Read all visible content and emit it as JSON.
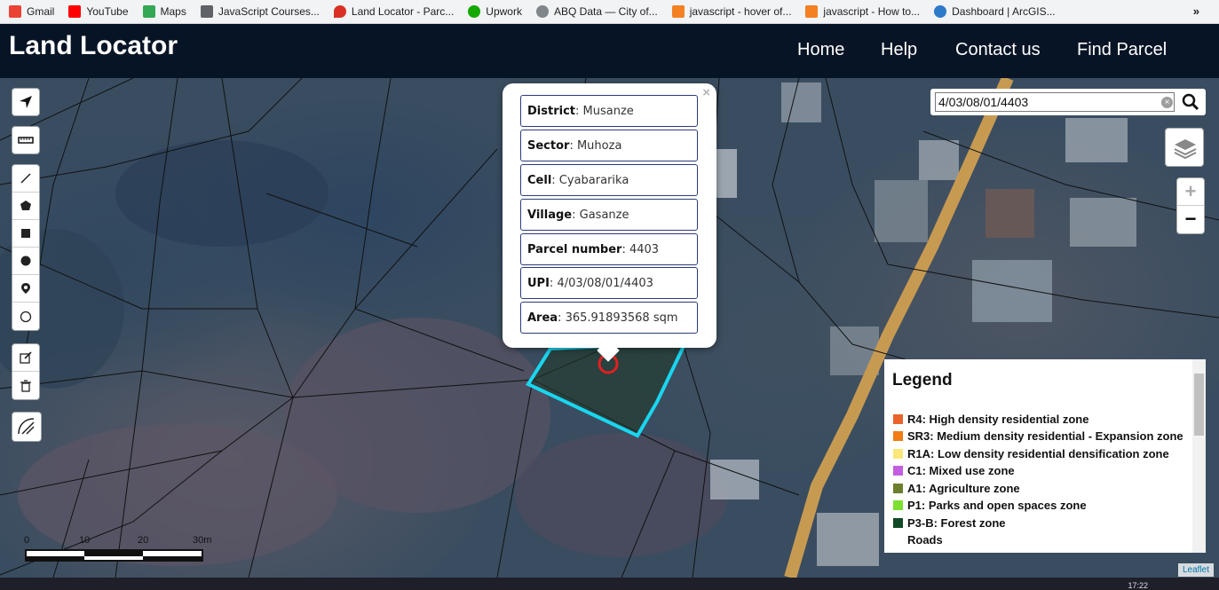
{
  "bookmarks": [
    {
      "label": "Gmail",
      "icon": "gmail-icon",
      "color": "#ea4335"
    },
    {
      "label": "YouTube",
      "icon": "youtube-icon",
      "color": "#ff0000"
    },
    {
      "label": "Maps",
      "icon": "maps-icon",
      "color": "#34a853"
    },
    {
      "label": "JavaScript Courses...",
      "icon": "page-icon",
      "color": "#5f6368"
    },
    {
      "label": "Land Locator - Parc...",
      "icon": "pin-icon",
      "color": "#d93025"
    },
    {
      "label": "Upwork",
      "icon": "upwork-icon",
      "color": "#14a800"
    },
    {
      "label": "ABQ Data — City of...",
      "icon": "globe-icon",
      "color": "#80868b"
    },
    {
      "label": "javascript - hover of...",
      "icon": "stackoverflow-icon",
      "color": "#f48024"
    },
    {
      "label": "javascript - How to...",
      "icon": "stackoverflow-icon",
      "color": "#f48024"
    },
    {
      "label": "Dashboard | ArcGIS...",
      "icon": "arcgis-icon",
      "color": "#2c7ac9"
    }
  ],
  "bookmarks_more": "»",
  "header": {
    "brand": "Land Locator",
    "nav": [
      "Home",
      "Help",
      "Contact us",
      "Find Parcel"
    ]
  },
  "search": {
    "value": "4/03/08/01/4403",
    "clear": "×"
  },
  "zoom": {
    "in": "+",
    "out": "−"
  },
  "popup": {
    "close": "×",
    "fields": [
      {
        "label": "District",
        "value": "Musanze"
      },
      {
        "label": "Sector",
        "value": "Muhoza"
      },
      {
        "label": "Cell",
        "value": "Cyabararika"
      },
      {
        "label": "Village",
        "value": "Gasanze"
      },
      {
        "label": "Parcel number",
        "value": "4403"
      },
      {
        "label": "UPI",
        "value": "4/03/08/01/4403"
      },
      {
        "label": "Area",
        "value": "365.91893568 sqm"
      }
    ]
  },
  "legend": {
    "title": "Legend",
    "items": [
      {
        "label": "R4: High density residential zone",
        "color": "#e8642a"
      },
      {
        "label": "SR3: Medium density residential - Expansion zone",
        "color": "#f07c12"
      },
      {
        "label": "R1A: Low density residential densification zone",
        "color": "#fbe77a"
      },
      {
        "label": "C1: Mixed use zone",
        "color": "#c35ee0"
      },
      {
        "label": "A1: Agriculture zone",
        "color": "#6b7f2d"
      },
      {
        "label": "P1: Parks and open spaces zone",
        "color": "#7ddf2f"
      },
      {
        "label": "P3-B: Forest zone",
        "color": "#0f4a26"
      },
      {
        "label": "Roads",
        "color": ""
      }
    ]
  },
  "scale": {
    "labels": [
      "0",
      "10",
      "20",
      "30m"
    ]
  },
  "attribution": "Leaflet",
  "clock": "17:22",
  "colors": {
    "header": "#071426",
    "parcel_outline": "#19d6f0",
    "marker": "#e02020"
  }
}
